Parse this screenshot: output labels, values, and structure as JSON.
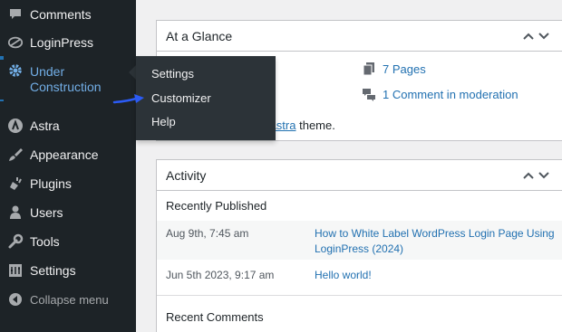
{
  "sidebar": {
    "items": [
      {
        "label": "Comments",
        "icon": "comment-icon"
      },
      {
        "label": "LoginPress",
        "icon": "loginpress-icon"
      },
      {
        "label": "Under\nConstruction",
        "icon": "gear-icon"
      },
      {
        "label": "Astra",
        "icon": "astra-icon"
      },
      {
        "label": "Appearance",
        "icon": "paintbrush-icon"
      },
      {
        "label": "Plugins",
        "icon": "plugin-icon"
      },
      {
        "label": "Users",
        "icon": "users-icon"
      },
      {
        "label": "Tools",
        "icon": "wrench-icon"
      },
      {
        "label": "Settings",
        "icon": "settings-icon"
      }
    ],
    "collapse_label": "Collapse menu",
    "accent": "#72aee6"
  },
  "flyout": {
    "items": [
      "Settings",
      "Customizer",
      "Help"
    ]
  },
  "at_a_glance": {
    "title": "At a Glance",
    "pages": "7 Pages",
    "comments_moderation": "1 Comment in moderation",
    "theme_prefix": "g",
    "theme_name": "Astra",
    "theme_suffix": "theme."
  },
  "activity": {
    "title": "Activity",
    "recently_published_label": "Recently Published",
    "posts": [
      {
        "date": "Aug 9th, 7:45 am",
        "title": "How to White Label WordPress Login Page Using LoginPress (2024)"
      },
      {
        "date": "Jun 5th 2023, 9:17 am",
        "title": "Hello world!"
      }
    ],
    "recent_comments_label": "Recent Comments"
  }
}
